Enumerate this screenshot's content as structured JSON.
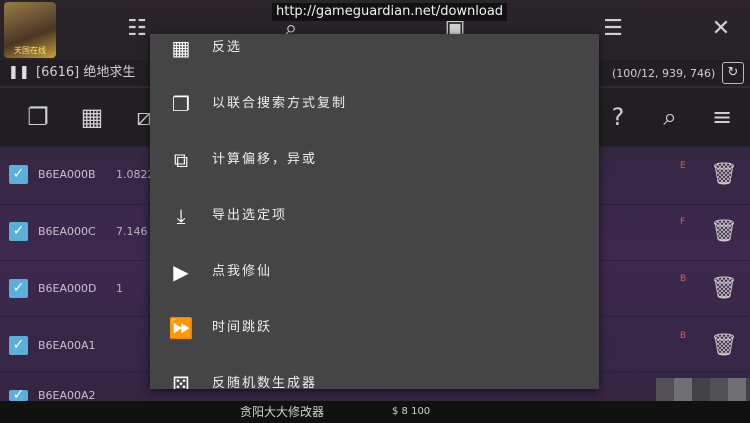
{
  "topbar": {
    "avatar_label": "天国在线",
    "url": "http://gameguardian.net/download"
  },
  "status": {
    "pause_glyph": "❚❚",
    "process": "[6616] 绝地求生",
    "counts": "(100/12, 939, 746)"
  },
  "rows": [
    {
      "address": "B6EA000B",
      "value": "1.0822"
    },
    {
      "address": "B6EA000C",
      "value": "7.146"
    },
    {
      "address": "B6EA000D",
      "value": "1"
    },
    {
      "address": "B6EA00A1",
      "value": ""
    },
    {
      "address": "B6EA00A2",
      "value": ""
    }
  ],
  "row_types": [
    "E",
    "F",
    "B",
    "B"
  ],
  "menu": {
    "items": [
      {
        "label": "反选",
        "icon": "select-invert-icon"
      },
      {
        "label": "以联合搜索方式复制",
        "icon": "copy-icon"
      },
      {
        "label": "计算偏移，异或",
        "icon": "offset-calc-icon"
      },
      {
        "label": "导出选定项",
        "icon": "export-icon"
      },
      {
        "label": "点我修仙",
        "icon": "play-icon"
      },
      {
        "label": "时间跳跃",
        "icon": "fast-forward-icon"
      },
      {
        "label": "反随机数生成器",
        "icon": "dice-icon"
      }
    ]
  },
  "bottom": {
    "ad_text": "贪阳大大修改器",
    "ad_extra": "$ 8 100"
  },
  "colors": {
    "menu_bg": "#454545",
    "checkbox": "#5ab0d8",
    "url_bg": "#111111"
  }
}
